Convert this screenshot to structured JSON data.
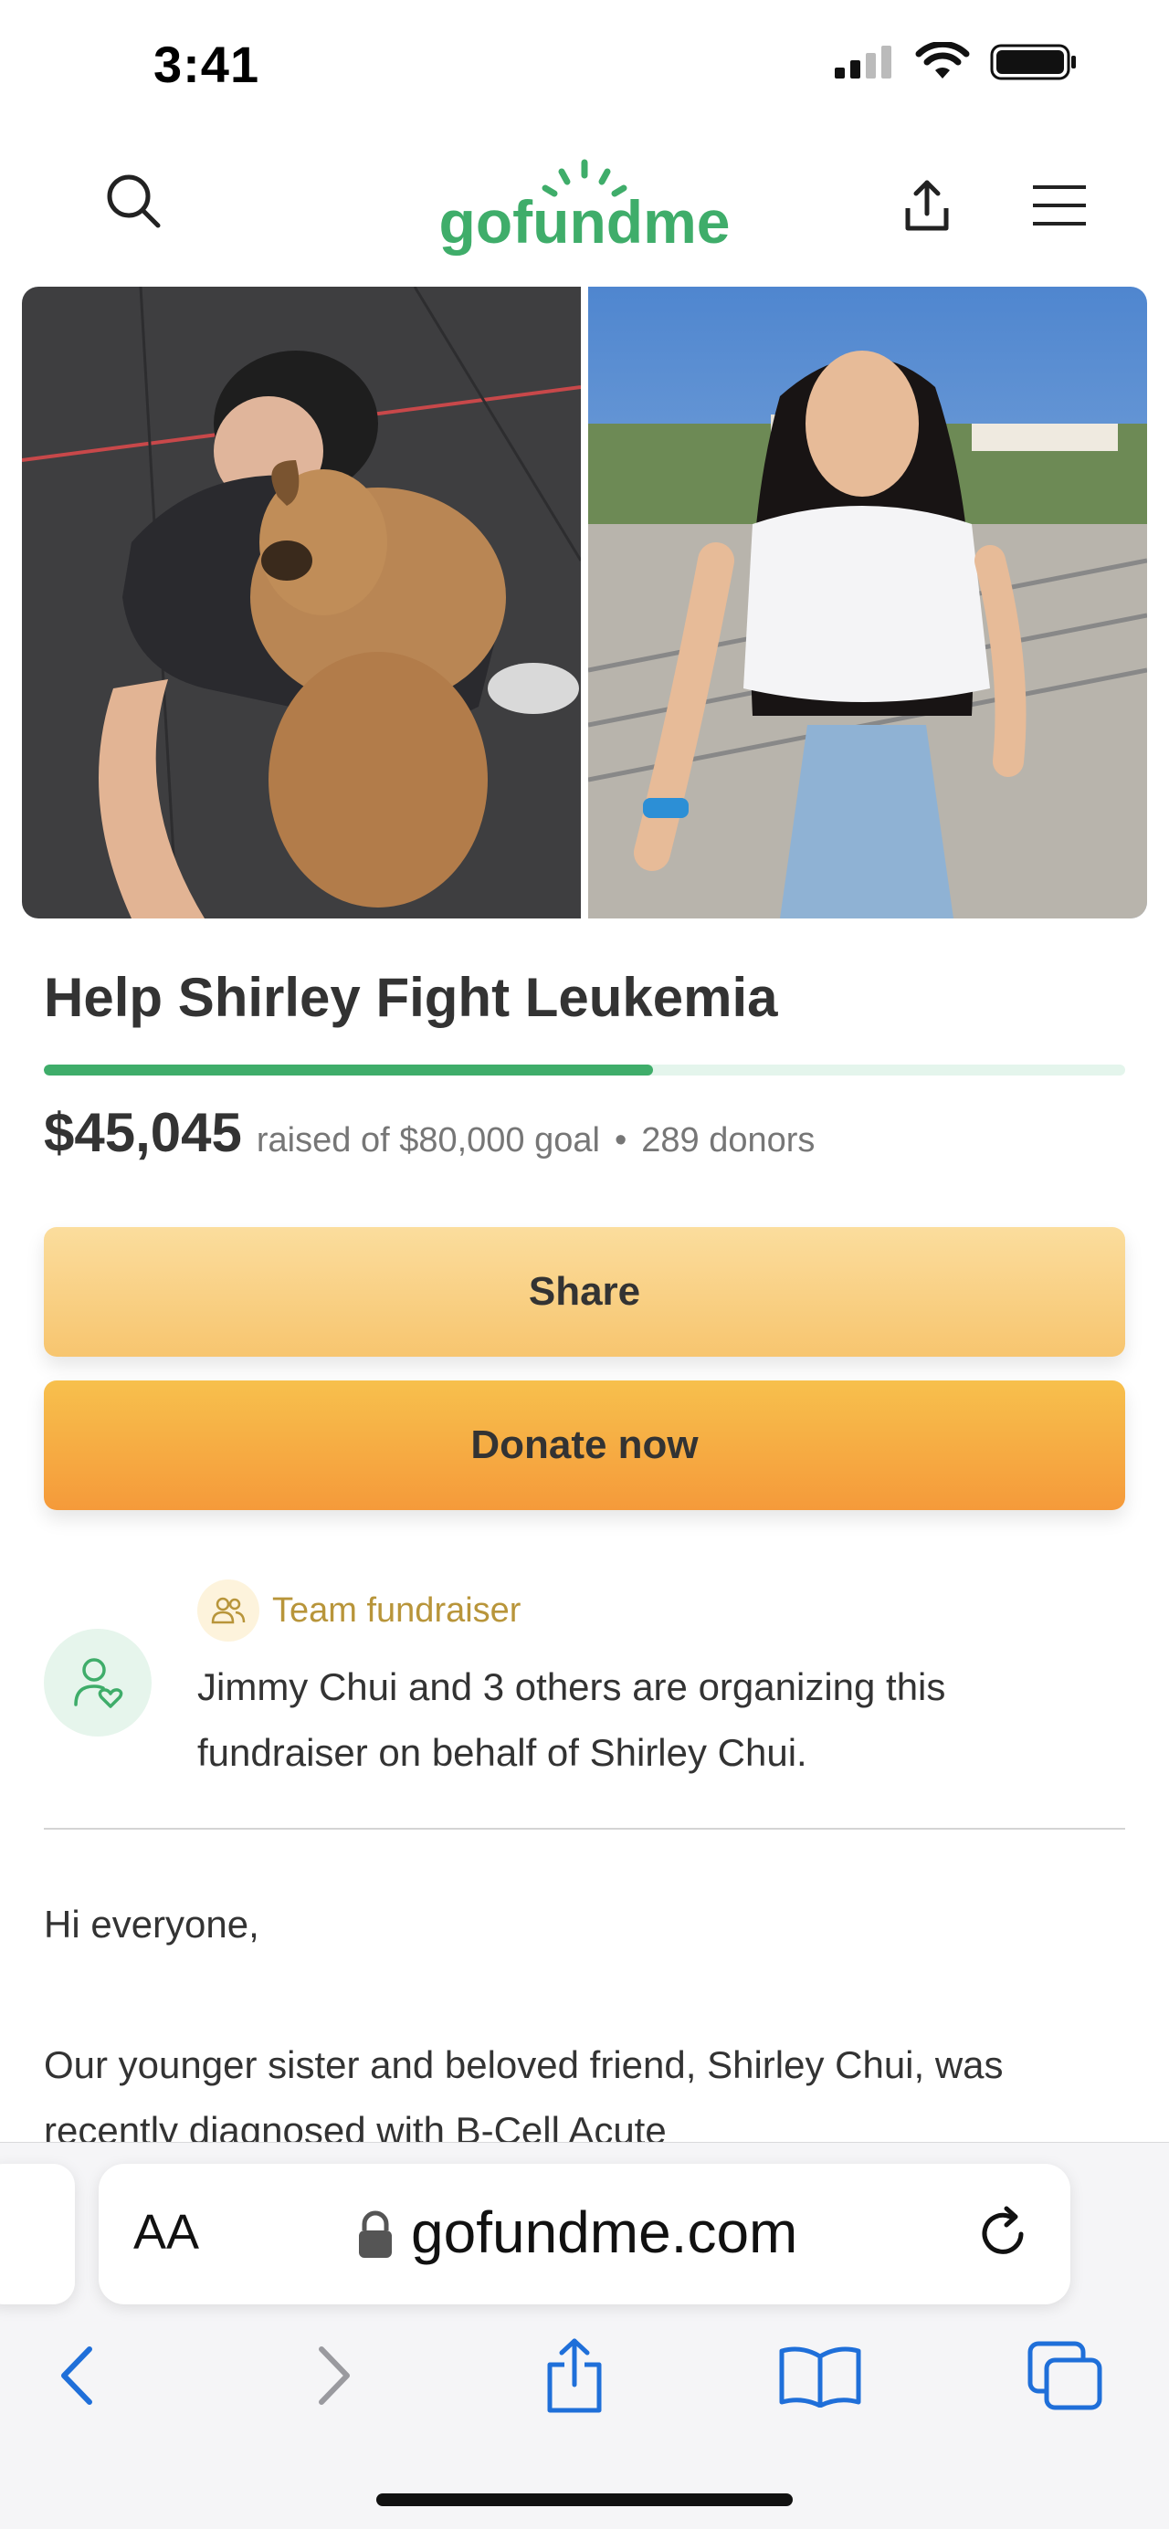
{
  "status_bar": {
    "time": "3:41"
  },
  "header": {
    "logo_text": "gofundme"
  },
  "campaign": {
    "title": "Help Shirley Fight Leukemia",
    "raised": "$45,045",
    "raised_suffix": "raised of $80,000 goal",
    "donors": "289 donors",
    "progress_fraction": 0.563
  },
  "buttons": {
    "share": "Share",
    "donate": "Donate now"
  },
  "organizer": {
    "badge": "Team fundraiser",
    "text": "Jimmy Chui and 3 others are organizing this fundraiser on behalf of Shirley Chui."
  },
  "story": {
    "greeting": "Hi everyone,",
    "paragraph": "Our younger sister and beloved friend, Shirley Chui, was recently diagnosed with B-Cell Acute"
  },
  "browser": {
    "text_size": "AA",
    "url": "gofundme.com"
  },
  "colors": {
    "brand_green": "#3fad6a",
    "button_orange": "#f59a3a",
    "safari_blue": "#1f6fd9"
  },
  "icons": [
    "search-icon",
    "share-icon",
    "menu-icon",
    "team-icon",
    "heart-person-icon",
    "lock-icon",
    "reload-icon",
    "back-icon",
    "forward-icon",
    "bookmarks-icon",
    "tabs-icon"
  ]
}
